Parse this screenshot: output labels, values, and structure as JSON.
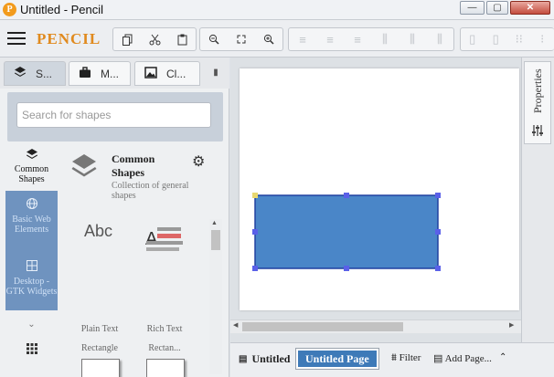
{
  "window": {
    "title": "Untitled - Pencil",
    "logo_letter": "P",
    "min_label": "—",
    "max_label": "▢",
    "close_label": "✕"
  },
  "toolbar": {
    "logo": "PENCIL"
  },
  "left_panel": {
    "tabs": [
      {
        "label": "S..."
      },
      {
        "label": "M..."
      },
      {
        "label": "Cl..."
      }
    ],
    "search": {
      "placeholder": "Search for shapes",
      "value": ""
    },
    "categories": [
      {
        "label": "Common Shapes"
      },
      {
        "label": "Basic Web Elements"
      },
      {
        "label": "Desktop - GTK Widgets"
      }
    ],
    "library": {
      "title": "Common Shapes",
      "description": "Collection of general shapes"
    },
    "shapes": [
      {
        "label": "Plain Text",
        "preview": "Abc"
      },
      {
        "label": "Rich Text"
      },
      {
        "label": "Rectangle"
      },
      {
        "label": "Rectan..."
      }
    ]
  },
  "canvas": {
    "selected_shape": "rectangle",
    "shape_fill": "#4a86c8",
    "shape_border": "#2040a0",
    "handle_color": "#5a60e8"
  },
  "right_panel": {
    "properties_label": "Properties"
  },
  "bottom_bar": {
    "pages": [
      {
        "label": "Untitled",
        "active": false
      },
      {
        "label": "Untitled Page",
        "active": true
      }
    ],
    "filter_label": "Filter",
    "add_page_label": "Add Page..."
  }
}
